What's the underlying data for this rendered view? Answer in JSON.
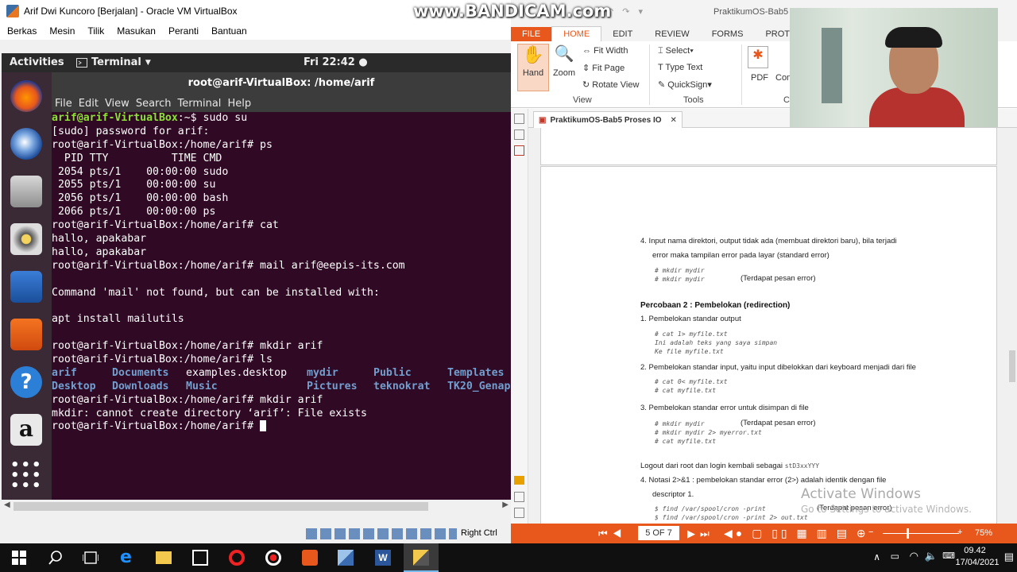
{
  "watermark": "www.BANDICAM.com",
  "vbox": {
    "title": "Arif Dwi Kuncoro [Berjalan] - Oracle VM VirtualBox",
    "menu": [
      "Berkas",
      "Mesin",
      "Tilik",
      "Masukan",
      "Peranti",
      "Bantuan"
    ],
    "host_key": "Right Ctrl"
  },
  "gnome": {
    "activities": "Activities",
    "app": "Terminal",
    "clock": "Fri 22:42"
  },
  "terminal": {
    "title": "root@arif-VirtualBox: /home/arif",
    "menu": [
      "File",
      "Edit",
      "View",
      "Search",
      "Terminal",
      "Help"
    ],
    "lines": {
      "l1_prompt": "arif@arif-VirtualBox",
      "l1_rest": ":~$ sudo su",
      "l2": "[sudo] password for arif:",
      "l3": "root@arif-VirtualBox:/home/arif# ps",
      "l4": "  PID TTY          TIME CMD",
      "l5": " 2054 pts/1    00:00:00 sudo",
      "l6": " 2055 pts/1    00:00:00 su",
      "l7": " 2056 pts/1    00:00:00 bash",
      "l8": " 2066 pts/1    00:00:00 ps",
      "l9": "root@arif-VirtualBox:/home/arif# cat",
      "l10": "hallo, apakabar",
      "l11": "hallo, apakabar",
      "l12": "root@arif-VirtualBox:/home/arif# mail arif@eepis-its.com",
      "l13": "",
      "l14": "Command 'mail' not found, but can be installed with:",
      "l15": "",
      "l16": "apt install mailutils",
      "l17": "",
      "l18": "root@arif-VirtualBox:/home/arif# mkdir arif",
      "l19": "root@arif-VirtualBox:/home/arif# ls",
      "l22": "root@arif-VirtualBox:/home/arif# mkdir arif",
      "l23": "mkdir: cannot create directory ‘arif’: File exists",
      "l24": "root@arif-VirtualBox:/home/arif# "
    },
    "ls_row1": [
      "arif",
      "Documents",
      "examples.desktop",
      "mydir",
      "Public",
      "Templates"
    ],
    "ls_row2": [
      "Desktop",
      "Downloads",
      "Music",
      "Pictures",
      "teknokrat",
      "TK20_Genap"
    ]
  },
  "pdf": {
    "window_title": "PraktikumOS-Bab5",
    "tabs": [
      "FILE",
      "HOME",
      "EDIT",
      "REVIEW",
      "FORMS",
      "PROTECT"
    ],
    "ribbon": {
      "hand": "Hand",
      "zoom": "Zoom",
      "fit_width": "Fit Width",
      "fit_page": "Fit Page",
      "rotate_view": "Rotate View",
      "group_view": "View",
      "select": "Select",
      "type_text": "Type Text",
      "quicksign": "QuickSign",
      "group_tools": "Tools",
      "pdf": "PDF",
      "com": "Com",
      "c": "C"
    },
    "doc_tab": "PraktikumOS-Bab5 Proses IO",
    "page_indicator": "5 OF 7",
    "zoom_pct": "75%",
    "content": {
      "item4": "4.   Input nama direktori, output tidak ada (membuat direktori baru), bila terjadi",
      "item4b": "error maka tampilan error pada layar (standard error)",
      "c1": "# mkdir mydir",
      "c2": "# mkdir mydir",
      "c2note": "(Terdapat pesan error)",
      "heading": "Percobaan 2 : Pembelokan (redirection)",
      "p1": "1.   Pembelokan standar output",
      "c3": "# cat 1> myfile.txt",
      "c4": "Ini adalah teks yang saya simpan",
      "c5": "Ke file myfile.txt",
      "p2": "2.   Pembelokan standar input, yaitu input dibelokkan dari keyboard menjadi dari file",
      "c6": "# cat 0< myfile.txt",
      "c7": "# cat myfile.txt",
      "p3": "3.   Pembelokan standar error untuk disimpan di file",
      "c8": "# mkdir mydir",
      "c8note": "(Terdapat pesan error)",
      "c9": "# mkdir mydir 2> myerror.txt",
      "c10": "# cat myfile.txt",
      "logout": "Logout dari root dan login kembali sebagai",
      "logout_user": "stD3xxYYY",
      "p4": "4.   Notasi 2>&1 : pembelokan standar error (2>) adalah identik dengan file",
      "p4b": "descriptor 1.",
      "c11": "$ find /var/spool/cron -print",
      "c11note": "(Terdapat pesan error)",
      "c12": "$ find /var/spool/cron -print 2> out.txt"
    }
  },
  "activate": {
    "line1": "Activate Windows",
    "line2": "Go to Settings to activate Windows."
  },
  "taskbar": {
    "time": "09.42",
    "date": "17/04/2021"
  }
}
